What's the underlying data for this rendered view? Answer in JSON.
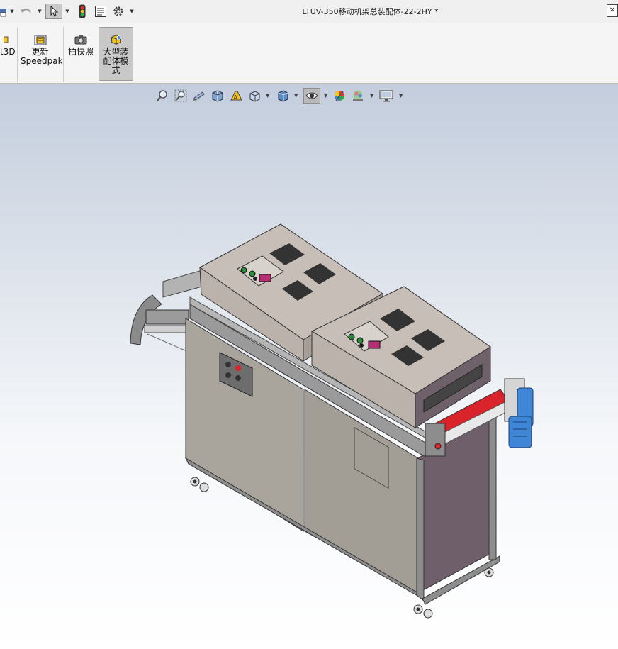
{
  "window": {
    "title": "LTUV-350移动机架总装配体-22-2HY *"
  },
  "quick_access": {
    "icons": [
      "print-icon",
      "undo-icon",
      "select-icon",
      "rebuild-icon",
      "file-properties-icon",
      "options-icon"
    ]
  },
  "ribbon": {
    "partial_label": "t3D",
    "update_speedpak": {
      "line1": "更新",
      "line2": "Speedpak"
    },
    "snapshot": {
      "label": "拍快照"
    },
    "large_assembly": {
      "line1": "大型装",
      "line2": "配体模",
      "line3": "式",
      "active": true
    }
  },
  "heads_up_toolbar": {
    "icons": [
      "zoom-to-fit-icon",
      "zoom-to-area-icon",
      "previous-view-icon",
      "section-view-icon",
      "dynamic-annotation-icon",
      "view-orientation-icon",
      "display-style-icon",
      "hide-show-items-icon",
      "edit-appearance-icon",
      "apply-scene-icon",
      "view-settings-icon"
    ],
    "active": "hide-show-items-icon"
  },
  "colors": {
    "cabinet": "#a9a49c",
    "lamp_housing": "#c6beb7",
    "frame": "#8d8d8d",
    "roller_red": "#d8242a",
    "motor_blue": "#3f86d6",
    "highlight": "#c8c8c8"
  }
}
